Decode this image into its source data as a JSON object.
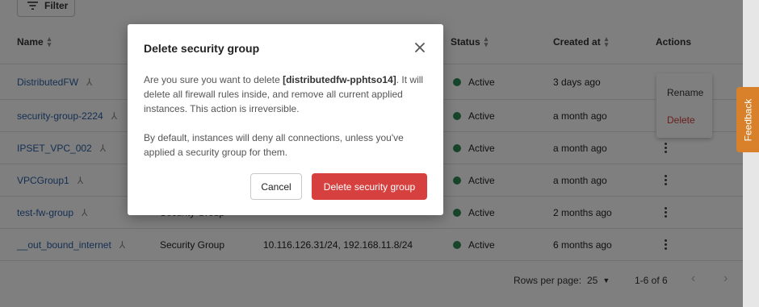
{
  "toolbar": {
    "filter_label": "Filter",
    "filter_icon": "filter-icon"
  },
  "table": {
    "columns": {
      "name": "Name",
      "status": "Status",
      "created_at": "Created at",
      "actions": "Actions"
    },
    "rows": [
      {
        "name": "DistributedFW",
        "type": "",
        "networks": "",
        "status": "Active",
        "created": "3 days ago"
      },
      {
        "name": "security-group-2224",
        "type": "",
        "networks": "",
        "status": "Active",
        "created": "a month ago"
      },
      {
        "name": "IPSET_VPC_002",
        "type": "",
        "networks": "",
        "status": "Active",
        "created": "a month ago"
      },
      {
        "name": "VPCGroup1",
        "type": "",
        "networks": "",
        "status": "Active",
        "created": "a month ago"
      },
      {
        "name": "test-fw-group",
        "type": "Security Group",
        "networks": "",
        "status": "Active",
        "created": "2 months ago"
      },
      {
        "name": "__out_bound_internet",
        "type": "Security Group",
        "networks": "10.116.126.31/24, 192.168.11.8/24",
        "status": "Active",
        "created": "6 months ago"
      }
    ]
  },
  "context_menu": {
    "rename": "Rename",
    "delete": "Delete"
  },
  "feedback": {
    "label": "Feedback"
  },
  "pagination": {
    "rows_per_page_label": "Rows per page:",
    "rows_per_page_value": "25",
    "range": "1-6 of 6"
  },
  "modal": {
    "title": "Delete security group",
    "body_prefix": "Are you sure you want to delete ",
    "group_name": "[distributedfw-pphtso14]",
    "body_suffix": ". It will delete all firewall rules inside, and remove all current applied instances. This action is irreversible.",
    "body_second": "By default, instances will deny all connections, unless you've applied a security group for them.",
    "cancel_label": "Cancel",
    "confirm_label": "Delete security group"
  },
  "colors": {
    "danger": "#d6403f",
    "link": "#2b5fa6",
    "active": "#2e8b57",
    "feedback": "#d9812a"
  }
}
